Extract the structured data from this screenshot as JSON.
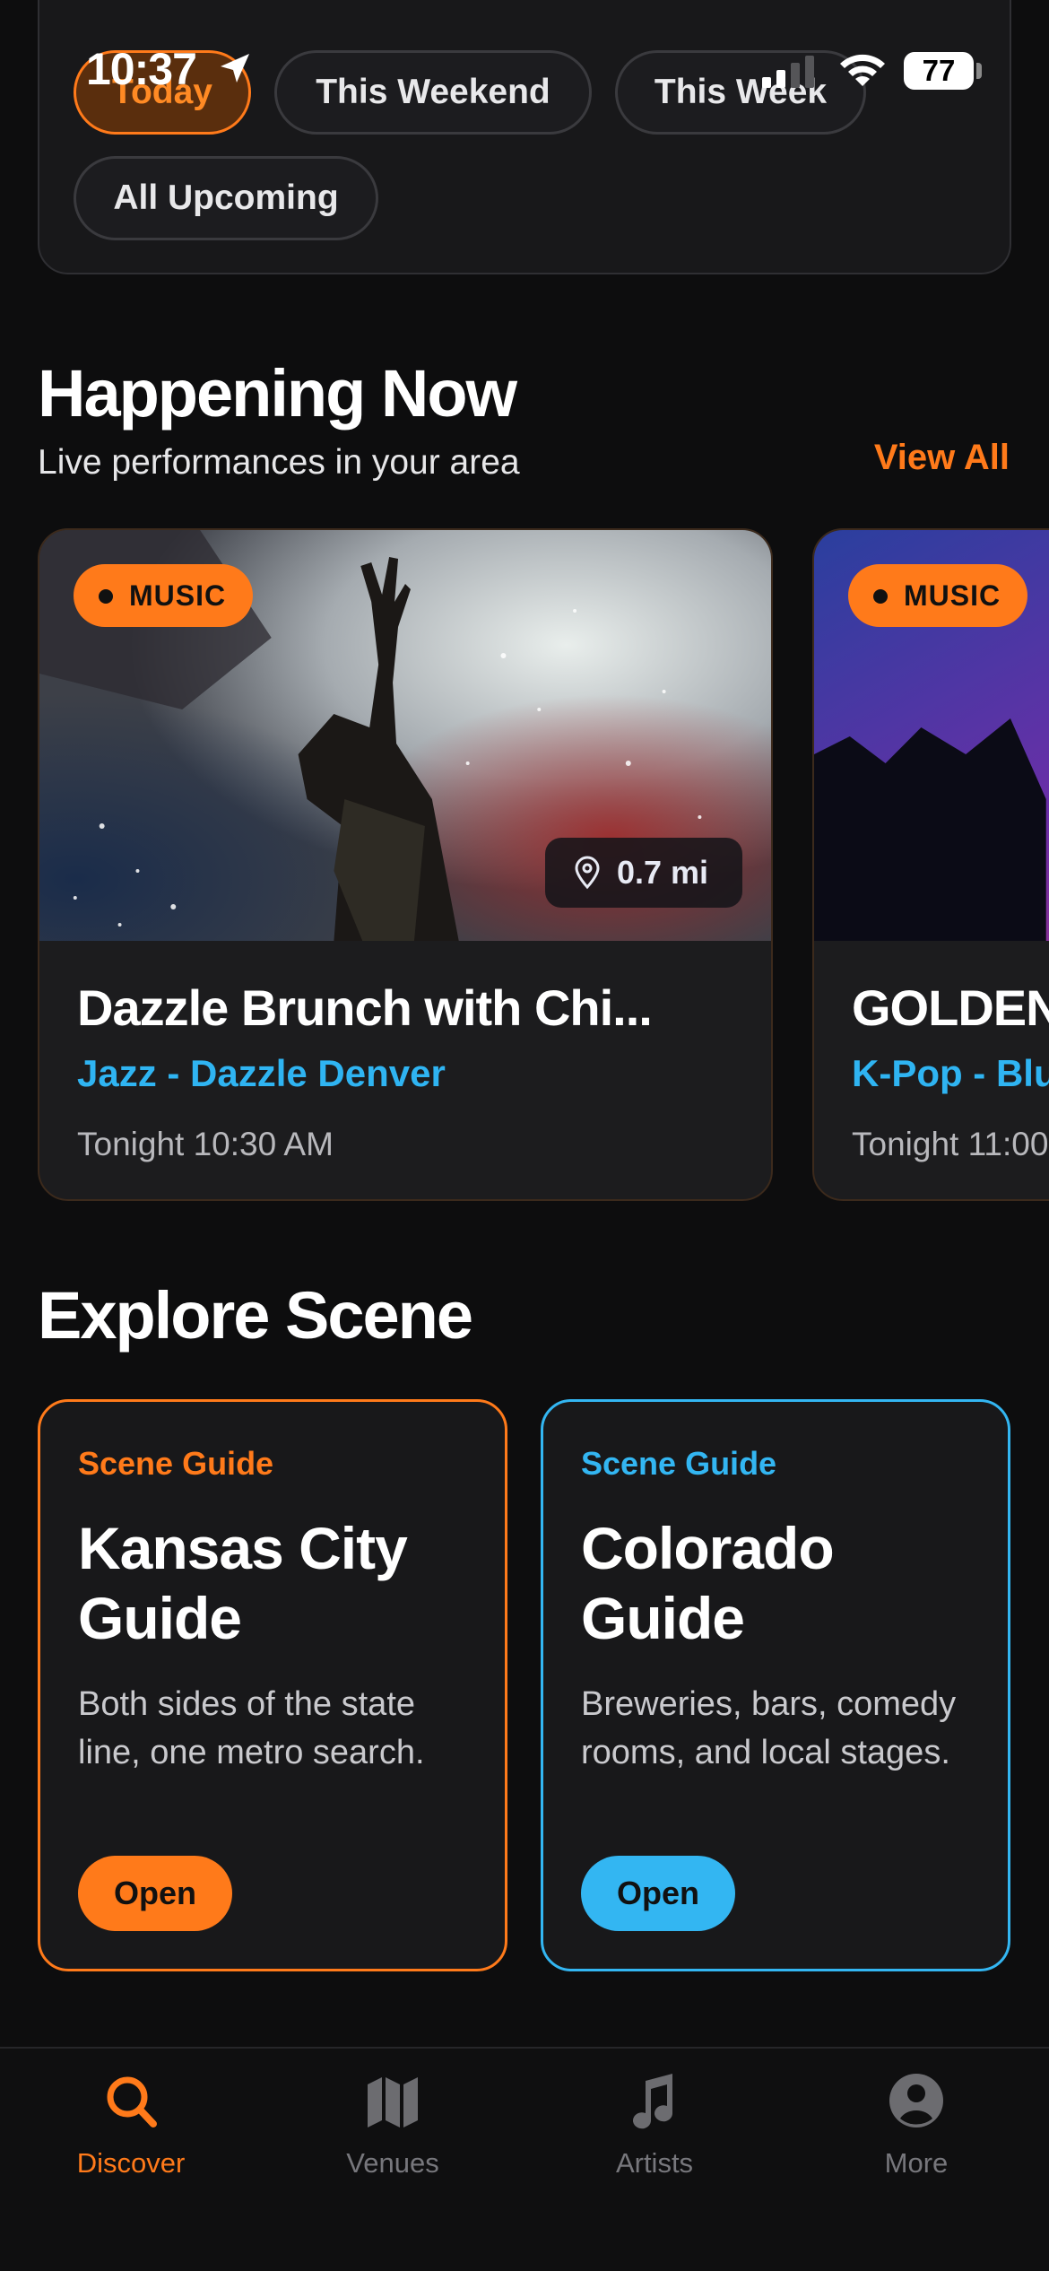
{
  "status_bar": {
    "time": "10:37",
    "battery": "77"
  },
  "filters": {
    "chips": [
      {
        "label": "Today",
        "active": true
      },
      {
        "label": "This Weekend",
        "active": false
      },
      {
        "label": "This Week",
        "active": false
      },
      {
        "label": "All Upcoming",
        "active": false
      }
    ]
  },
  "happening_now": {
    "title": "Happening Now",
    "subtitle": "Live performances in your area",
    "view_all": "View All",
    "events": [
      {
        "badge": "MUSIC",
        "distance": "0.7 mi",
        "title": "Dazzle Brunch with Chi...",
        "genre_venue": "Jazz - Dazzle Denver",
        "time": "Tonight 10:30 AM"
      },
      {
        "badge": "MUSIC",
        "title": "GOLDEN",
        "genre_venue": "K-Pop - Blu",
        "time": "Tonight 11:00"
      }
    ]
  },
  "explore_scene": {
    "title": "Explore Scene",
    "guides": [
      {
        "kicker": "Scene Guide",
        "title": "Kansas City Guide",
        "description": "Both sides of the state line, one metro search.",
        "button": "Open",
        "accent": "#ff7a1a"
      },
      {
        "kicker": "Scene Guide",
        "title": "Colorado Guide",
        "description": "Breweries, bars, comedy rooms, and local stages.",
        "button": "Open",
        "accent": "#33b6f2"
      }
    ]
  },
  "tab_bar": {
    "tabs": [
      {
        "label": "Discover",
        "icon": "search-icon",
        "active": true
      },
      {
        "label": "Venues",
        "icon": "map-icon",
        "active": false
      },
      {
        "label": "Artists",
        "icon": "music-note-icon",
        "active": false
      },
      {
        "label": "More",
        "icon": "person-circle-icon",
        "active": false
      }
    ]
  },
  "colors": {
    "accent_orange": "#ff7a1a",
    "accent_blue": "#33b6f2",
    "background": "#0d0d0e",
    "card": "#1c1c1e"
  }
}
